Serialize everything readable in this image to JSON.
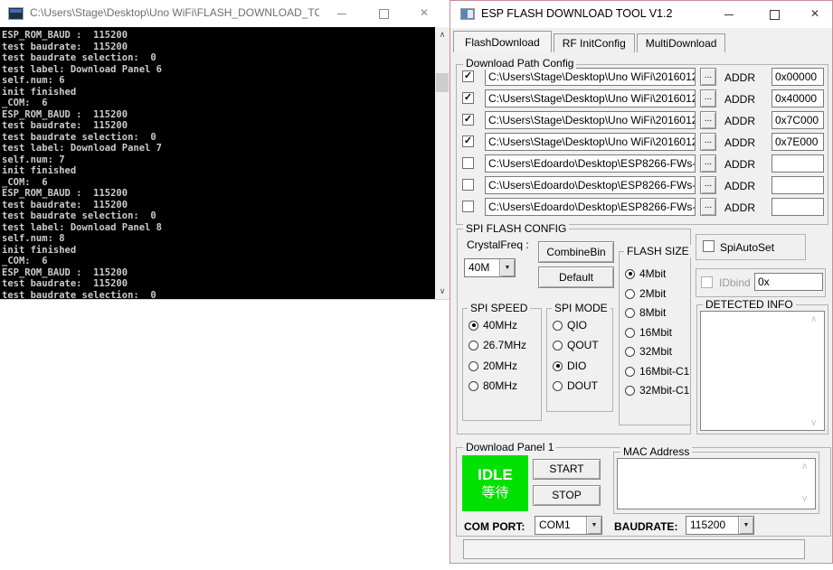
{
  "console_window": {
    "title": "C:\\Users\\Stage\\Desktop\\Uno WiFi\\FLASH_DOWNLOAD_TO...",
    "lines": [
      "ESP_ROM_BAUD :  115200",
      "test baudrate:  115200",
      "test baudrate selection:  0",
      "test label: Download Panel 6",
      "self.num: 6",
      "init finished",
      "_COM:  6",
      "ESP_ROM_BAUD :  115200",
      "test baudrate:  115200",
      "test baudrate selection:  0",
      "test label: Download Panel 7",
      "self.num: 7",
      "init finished",
      "_COM:  6",
      "ESP_ROM_BAUD :  115200",
      "test baudrate:  115200",
      "test baudrate selection:  0",
      "test label: Download Panel 8",
      "self.num: 8",
      "init finished",
      "_COM:  6",
      "ESP_ROM_BAUD :  115200",
      "test baudrate:  115200",
      "test baudrate selection:  0"
    ]
  },
  "tool_window": {
    "title": "ESP FLASH DOWNLOAD TOOL V1.2",
    "tabs": [
      {
        "label": "FlashDownload",
        "active": true
      },
      {
        "label": "RF InitConfig",
        "active": false
      },
      {
        "label": "MultiDownload",
        "active": false
      }
    ],
    "download_path_config": {
      "legend": "Download Path Config",
      "addr_label": "ADDR",
      "browse_label": "...",
      "rows": [
        {
          "checked": true,
          "path": "C:\\Users\\Stage\\Desktop\\Uno WiFi\\2016012",
          "addr": "0x00000"
        },
        {
          "checked": true,
          "path": "C:\\Users\\Stage\\Desktop\\Uno WiFi\\2016012",
          "addr": "0x40000"
        },
        {
          "checked": true,
          "path": "C:\\Users\\Stage\\Desktop\\Uno WiFi\\2016012",
          "addr": "0x7C000"
        },
        {
          "checked": true,
          "path": "C:\\Users\\Stage\\Desktop\\Uno WiFi\\2016012",
          "addr": "0x7E000"
        },
        {
          "checked": false,
          "path": "C:\\Users\\Edoardo\\Desktop\\ESP8266-FWs-",
          "addr": ""
        },
        {
          "checked": false,
          "path": "C:\\Users\\Edoardo\\Desktop\\ESP8266-FWs-",
          "addr": ""
        },
        {
          "checked": false,
          "path": "C:\\Users\\Edoardo\\Desktop\\ESP8266-FWs-",
          "addr": ""
        }
      ]
    },
    "spi_flash_config": {
      "legend": "SPI FLASH CONFIG",
      "crystal_freq_label": "CrystalFreq :",
      "crystal_freq_value": "40M",
      "combine_bin_label": "CombineBin",
      "default_label": "Default",
      "spi_speed": {
        "legend": "SPI SPEED",
        "options": [
          {
            "label": "40MHz",
            "selected": true
          },
          {
            "label": "26.7MHz",
            "selected": false
          },
          {
            "label": "20MHz",
            "selected": false
          },
          {
            "label": "80MHz",
            "selected": false
          }
        ]
      },
      "spi_mode": {
        "legend": "SPI MODE",
        "options": [
          {
            "label": "QIO",
            "selected": false
          },
          {
            "label": "QOUT",
            "selected": false
          },
          {
            "label": "DIO",
            "selected": true
          },
          {
            "label": "DOUT",
            "selected": false
          }
        ]
      },
      "flash_size": {
        "legend": "FLASH SIZE",
        "options": [
          {
            "label": "4Mbit",
            "selected": true
          },
          {
            "label": "2Mbit",
            "selected": false
          },
          {
            "label": "8Mbit",
            "selected": false
          },
          {
            "label": "16Mbit",
            "selected": false
          },
          {
            "label": "32Mbit",
            "selected": false
          },
          {
            "label": "16Mbit-C1",
            "selected": false
          },
          {
            "label": "32Mbit-C1",
            "selected": false
          }
        ]
      }
    },
    "spi_auto_set": {
      "label": "SpiAutoSet",
      "checked": false
    },
    "id_bind": {
      "label": "IDbind",
      "checked": false,
      "value": "0x"
    },
    "detected_info": {
      "legend": "DETECTED INFO",
      "content": ""
    },
    "download_panel": {
      "legend": "Download Panel 1",
      "status_primary": "IDLE",
      "status_secondary": "等待",
      "status_color": "#00e100",
      "start_label": "START",
      "stop_label": "STOP",
      "mac_legend": "MAC Address",
      "mac_content": "",
      "com_port_label": "COM PORT:",
      "com_port_value": "COM1",
      "baudrate_label": "BAUDRATE:",
      "baudrate_value": "115200"
    }
  }
}
